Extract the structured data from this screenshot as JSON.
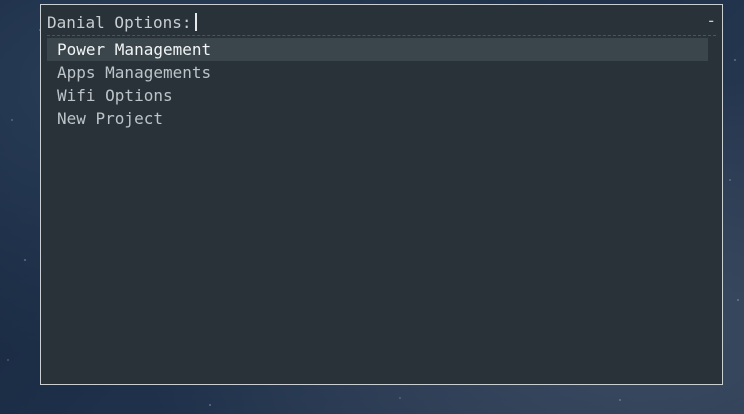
{
  "launcher": {
    "prompt": "Danial Options:",
    "input_value": "",
    "case_indicator": "-",
    "items": [
      {
        "label": "Power Management",
        "selected": true
      },
      {
        "label": "Apps Managements",
        "selected": false
      },
      {
        "label": "Wifi Options",
        "selected": false
      },
      {
        "label": "New Project",
        "selected": false
      }
    ]
  },
  "colors": {
    "window_bg": "#283238",
    "border": "#c9cfd3",
    "selected_bg": "#3a464c",
    "text": "#bcc4c9",
    "selected_text": "#f2f4f5"
  }
}
